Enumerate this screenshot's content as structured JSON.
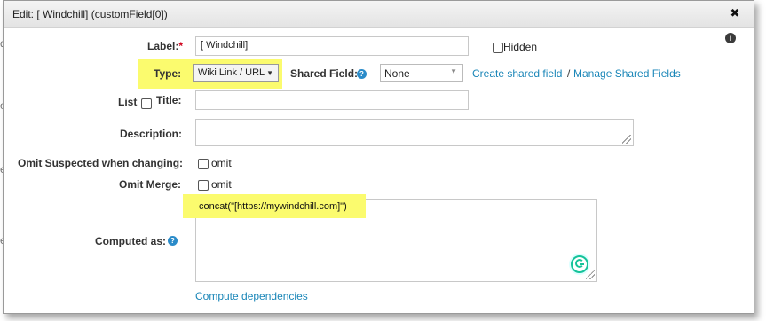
{
  "background": {
    "frag1": "d",
    "frag2": "o",
    "frag3": "e",
    "frag4": "e"
  },
  "dialog": {
    "title": "Edit: [ Windchill] (customField[0])",
    "close_icon": "close-icon",
    "info_icon": "info-icon"
  },
  "form": {
    "label_label": "Label:",
    "label_required": "*",
    "label_value": "[ Windchill]",
    "hidden_label": "Hidden",
    "hidden_checked": false,
    "type_label": "Type:",
    "type_value": "Wiki Link / URL",
    "shared_field_label": "Shared Field:",
    "shared_field_value": "None",
    "create_shared_link": "Create shared field",
    "separator": "/",
    "manage_shared_link": "Manage Shared Fields",
    "list_label": "List",
    "list_checked": false,
    "title_label": "Title:",
    "title_value": "",
    "description_label": "Description:",
    "description_value": "",
    "omit_suspected_label": "Omit Suspected when changing:",
    "omit_suspected_option": "omit",
    "omit_suspected_checked": false,
    "omit_merge_label": "Omit Merge:",
    "omit_merge_option": "omit",
    "omit_merge_checked": false,
    "computed_as_label": "Computed as:",
    "computed_as_value": "concat(\"[https://mywindchill.com]\")",
    "compute_dependencies_link": "Compute dependencies"
  },
  "colors": {
    "highlight": "#fbfb6e",
    "link": "#1a86b8",
    "help": "#2a8bc9",
    "required": "#d0021b",
    "grammarly": "#15c39a"
  }
}
